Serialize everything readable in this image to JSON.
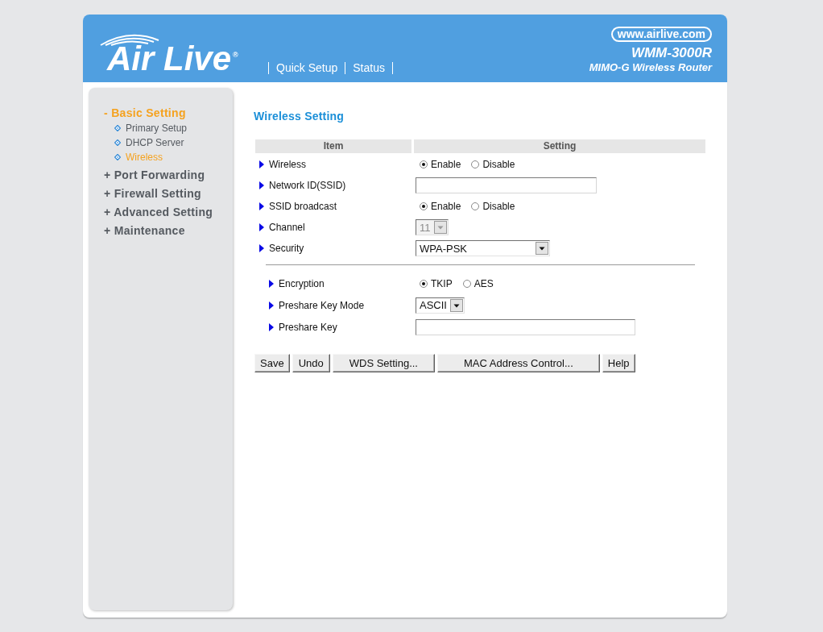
{
  "header": {
    "logo": "Air Live$^{®}$",
    "nav": [
      "Quick Setup",
      "Status"
    ],
    "website": "www.airlive.com",
    "model": "WMM-3000R",
    "product": "MIMO-G Wireless Router"
  },
  "sidebar": {
    "sections": [
      {
        "label": "- Basic Setting",
        "selected": true,
        "children": [
          {
            "label": "Primary Setup",
            "selected": false
          },
          {
            "label": "DHCP Server",
            "selected": false
          },
          {
            "label": "Wireless",
            "selected": true
          }
        ]
      },
      {
        "label": "+ Port Forwarding",
        "selected": false
      },
      {
        "label": "+ Firewall Setting",
        "selected": false
      },
      {
        "label": "+ Advanced Setting",
        "selected": false
      },
      {
        "label": "+ Maintenance",
        "selected": false
      }
    ]
  },
  "content": {
    "title": "Wireless Setting",
    "settings": {
      "columns": [
        "Item",
        "Setting"
      ],
      "rows": [
        {
          "label": "Wireless",
          "kind": "radio",
          "options": [
            {
              "label": "Enable",
              "selected": true
            },
            {
              "label": "Disable",
              "selected": false
            }
          ]
        },
        {
          "label": "Network ID(SSID)",
          "kind": "text"
        },
        {
          "label": "SSID broadcast",
          "kind": "radio",
          "options": [
            {
              "label": "Enable",
              "selected": true
            },
            {
              "label": "Disable",
              "selected": false
            }
          ]
        },
        {
          "label": "Channel",
          "kind": "select",
          "value": "11",
          "disabled": true
        },
        {
          "label": "Security",
          "kind": "select",
          "value": "WPA-PSK",
          "disabled": false
        }
      ]
    },
    "security": {
      "rows": [
        {
          "label": "Encryption",
          "kind": "radio",
          "options": [
            {
              "label": "TKIP",
              "selected": true
            },
            {
              "label": "AES",
              "selected": false
            }
          ]
        },
        {
          "label": "Preshare Key Mode",
          "kind": "select",
          "value": "ASCII",
          "disabled": false
        },
        {
          "label": "Preshare Key",
          "kind": "text"
        }
      ]
    },
    "buttons": [
      "Save",
      "Undo",
      "WDS Setting...",
      "MAC Address Control...",
      "Help"
    ]
  }
}
